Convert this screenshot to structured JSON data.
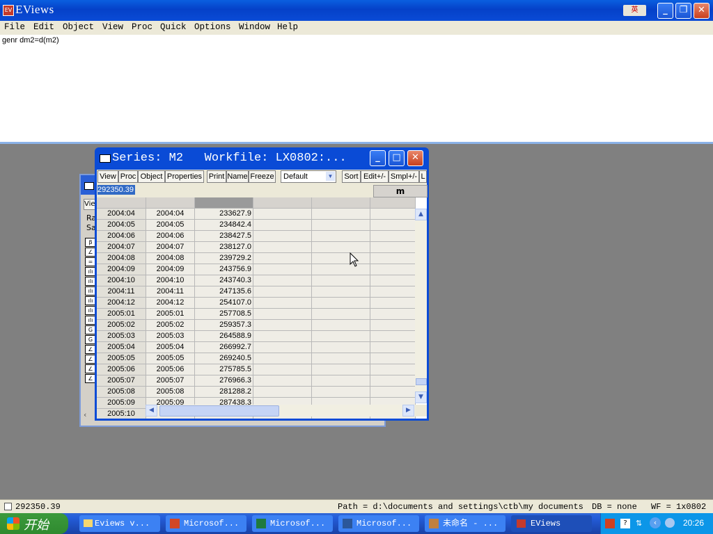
{
  "app": {
    "title": "EViews"
  },
  "menu": [
    "File",
    "Edit",
    "Object",
    "View",
    "Proc",
    "Quick",
    "Options",
    "Window",
    "Help"
  ],
  "command": {
    "text": "genr dm2=d(m2)"
  },
  "background_window": {
    "btn": "Vie",
    "label1": "Ra",
    "label2": "Sa",
    "icons": [
      "β",
      "∠",
      "=",
      "ılı",
      "ılı",
      "ılı",
      "ılı",
      "ılı",
      "ılı",
      "G",
      "G",
      "∠",
      "∠",
      "∠",
      "∠"
    ]
  },
  "series_window": {
    "title": "Series: M2   Workfile: LX0802:...",
    "toolbar": [
      "View",
      "Proc",
      "Object",
      "Properties",
      "Print",
      "Name",
      "Freeze",
      "Default",
      "Sort",
      "Edit+/-",
      "Smpl+/-",
      "L"
    ],
    "edit_value": "292350.39",
    "column_header": "m",
    "rows": [
      [
        "2004:04",
        "2004:04",
        "233627.9"
      ],
      [
        "2004:05",
        "2004:05",
        "234842.4"
      ],
      [
        "2004:06",
        "2004:06",
        "238427.5"
      ],
      [
        "2004:07",
        "2004:07",
        "238127.0"
      ],
      [
        "2004:08",
        "2004:08",
        "239729.2"
      ],
      [
        "2004:09",
        "2004:09",
        "243756.9"
      ],
      [
        "2004:10",
        "2004:10",
        "243740.3"
      ],
      [
        "2004:11",
        "2004:11",
        "247135.6"
      ],
      [
        "2004:12",
        "2004:12",
        "254107.0"
      ],
      [
        "2005:01",
        "2005:01",
        "257708.5"
      ],
      [
        "2005:02",
        "2005:02",
        "259357.3"
      ],
      [
        "2005:03",
        "2005:03",
        "264588.9"
      ],
      [
        "2005:04",
        "2005:04",
        "266992.7"
      ],
      [
        "2005:05",
        "2005:05",
        "269240.5"
      ],
      [
        "2005:06",
        "2005:06",
        "275785.5"
      ],
      [
        "2005:07",
        "2005:07",
        "276966.3"
      ],
      [
        "2005:08",
        "2005:08",
        "281288.2"
      ],
      [
        "2005:09",
        "2005:09",
        "287438.3"
      ],
      [
        "2005:10",
        "",
        ""
      ]
    ]
  },
  "status": {
    "value": "292350.39",
    "path": "Path = d:\\documents and settings\\ctb\\my documents",
    "db": "DB = none",
    "wf": "WF = 1x0802"
  },
  "taskbar": {
    "start": "开始",
    "tasks": [
      "Eviews v...",
      "Microsof...",
      "Microsof...",
      "Microsof...",
      "未命名 - ...",
      "EViews"
    ],
    "clock": "20:26"
  }
}
